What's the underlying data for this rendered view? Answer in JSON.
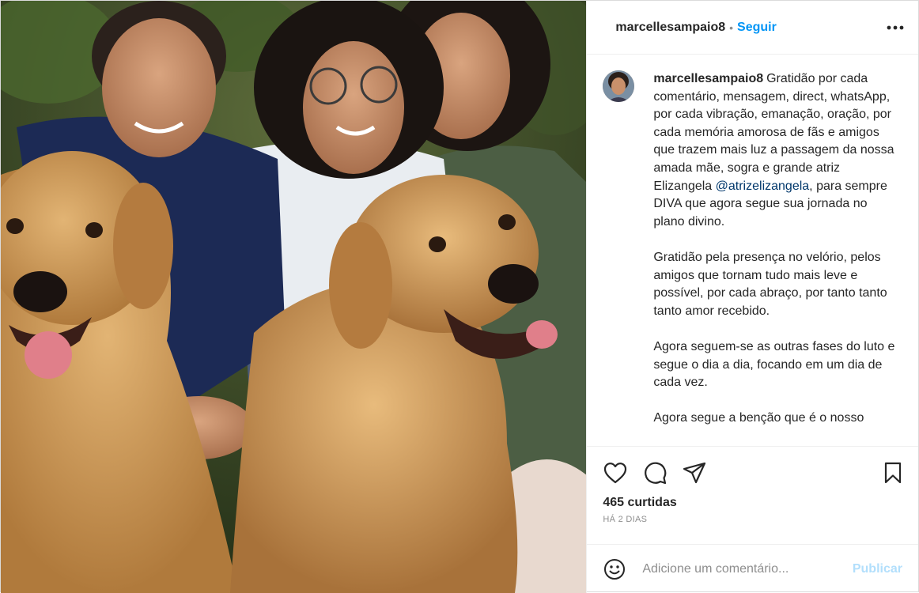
{
  "header": {
    "username": "marcellesampaio8",
    "separator": "•",
    "follow_label": "Seguir",
    "more_icon": "more-horizontal-icon"
  },
  "caption": {
    "username": "marcellesampaio8",
    "paragraph1_before_mention": "Gratidão por cada comentário, mensagem, direct, whatsApp, por cada vibração, emanação, oração, por cada memória amorosa de fãs e amigos que trazem mais luz a passagem da nossa amada mãe, sogra e grande atriz Elizangela ",
    "mention": "@atrizelizangela",
    "paragraph1_after_mention": ", para sempre DIVA que agora segue sua jornada no plano divino.",
    "paragraph2": "Gratidão pela presença no velório, pelos amigos que tornam tudo mais leve e possível, por cada abraço, por tanto tanto tanto amor recebido.",
    "paragraph3": "Agora seguem-se as outras fases do luto e segue o dia a dia, focando em um dia de cada vez.",
    "paragraph4": "Agora segue a benção que é o nosso"
  },
  "actions": {
    "like_icon": "heart-icon",
    "comment_icon": "comment-icon",
    "share_icon": "send-icon",
    "save_icon": "bookmark-icon",
    "likes_text": "465 curtidas",
    "time_text": "HÁ 2 DIAS"
  },
  "comment": {
    "emoji_icon": "emoji-icon",
    "placeholder": "Adicione um comentário...",
    "publish_label": "Publicar"
  },
  "colors": {
    "accent": "#0095f6",
    "publish_disabled": "#b2dffc",
    "mention": "#00376b",
    "muted": "#8e8e8e"
  }
}
